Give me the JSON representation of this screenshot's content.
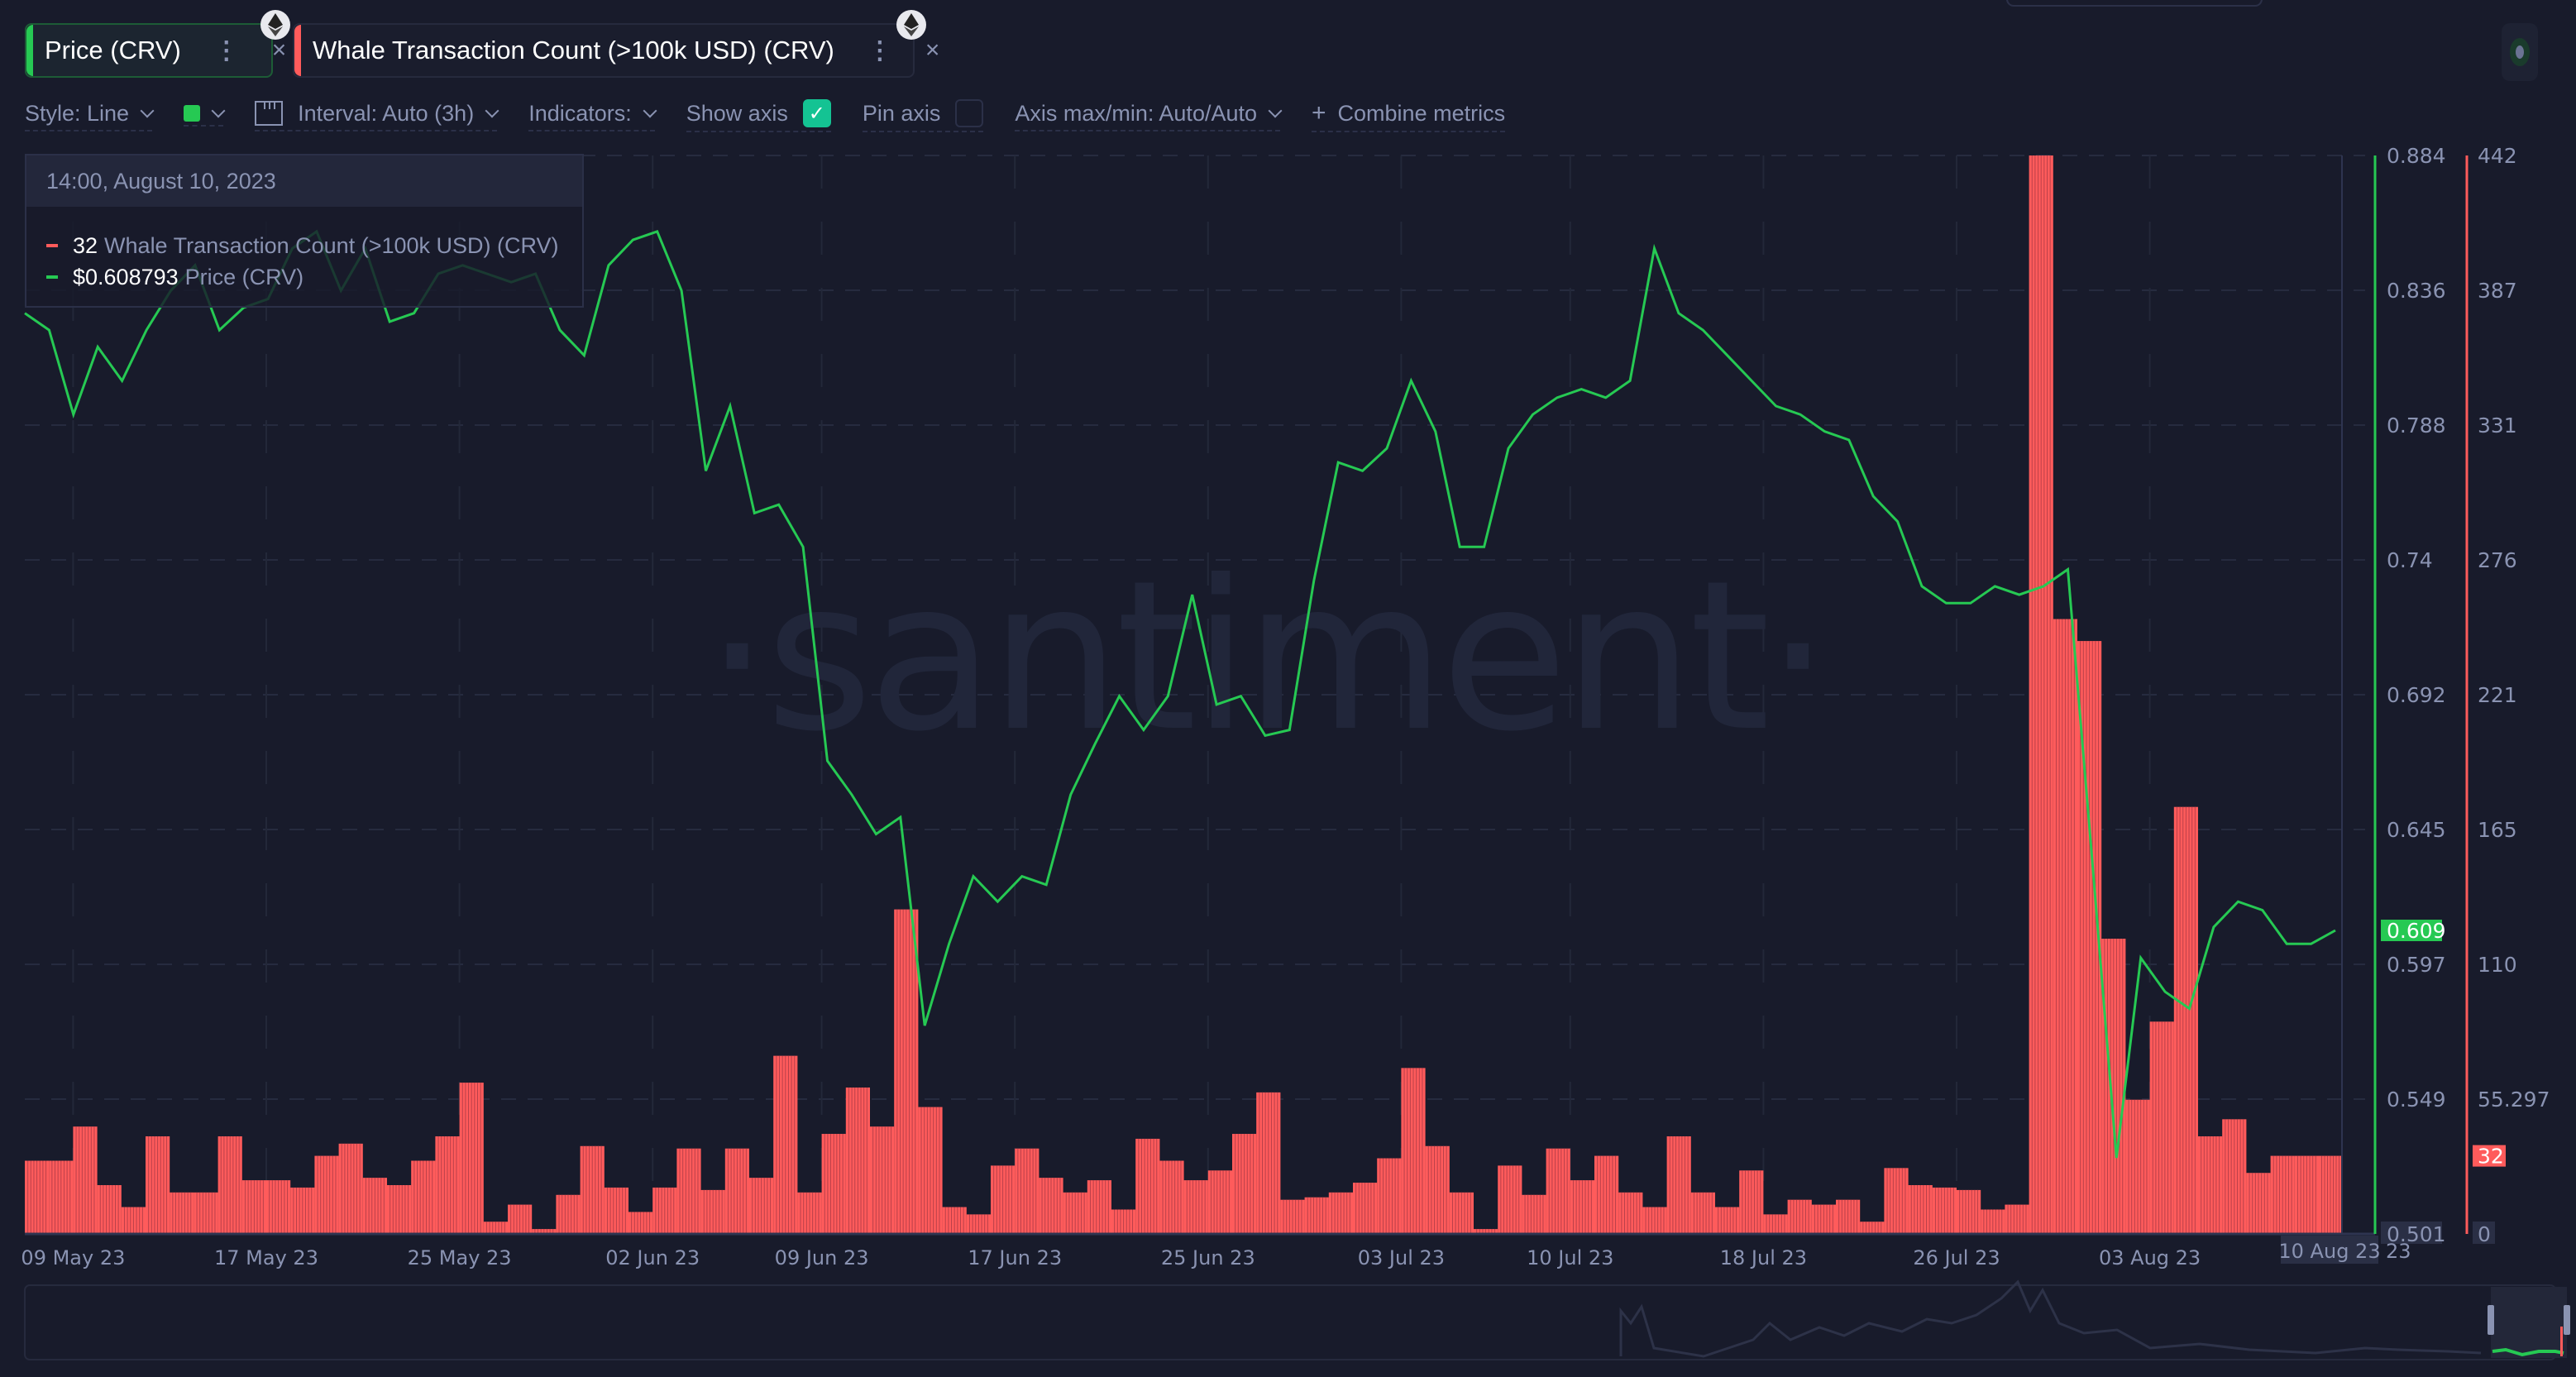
{
  "tabs": [
    {
      "label": "Price (CRV)",
      "color": "#26c953",
      "more_icon": "more-vertical-icon",
      "close_icon": "close-icon",
      "asset_icon": "ethereum-icon"
    },
    {
      "label": "Whale Transaction Count (>100k USD) (CRV)",
      "color": "#ff5b5b",
      "more_icon": "more-vertical-icon",
      "close_icon": "close-icon",
      "asset_icon": "ethereum-icon"
    }
  ],
  "toolbar": {
    "style_label": "Style: Line",
    "color_swatch": "#26c953",
    "interval_label": "Interval: Auto (3h)",
    "indicators_label": "Indicators:",
    "show_axis_label": "Show axis",
    "show_axis_checked": true,
    "pin_axis_label": "Pin axis",
    "pin_axis_checked": false,
    "axis_minmax_label": "Axis max/min: Auto/Auto",
    "combine_label": "Combine metrics",
    "combine_icon": "+"
  },
  "tooltip": {
    "datetime": "14:00, August 10, 2023",
    "rows": [
      {
        "value": "32",
        "name": "Whale Transaction Count (>100k USD) (CRV)",
        "color": "#ff5b5b"
      },
      {
        "value": "$0.608793",
        "name": "Price (CRV)",
        "color": "#26c953"
      }
    ]
  },
  "watermark": "·santiment·",
  "chart_data": {
    "type": "line+bar",
    "title": "",
    "x_start": "2023-05-07",
    "x_end": "2023-08-10 14:00",
    "x_ticks": [
      "09 May 23",
      "17 May 23",
      "25 May 23",
      "02 Jun 23",
      "09 Jun 23",
      "17 Jun 23",
      "25 Jun 23",
      "03 Jul 23",
      "10 Jul 23",
      "18 Jul 23",
      "26 Jul 23",
      "03 Aug 23"
    ],
    "x_tick_days": [
      2,
      10,
      18,
      26,
      33,
      41,
      49,
      57,
      64,
      72,
      80,
      88
    ],
    "x_cursor_label": "10 Aug 23",
    "x_cursor_trailing": "23",
    "grid": true,
    "series": [
      {
        "name": "Price (CRV)",
        "type": "line",
        "color": "#26c953",
        "axis": "left-inner",
        "ylim": [
          0.501,
          0.884
        ],
        "y_ticks": [
          "0.884",
          "0.836",
          "0.788",
          "0.74",
          "0.692",
          "0.645",
          "0.597",
          "0.549",
          "0.501"
        ],
        "last_value_label": "0.609",
        "interval": "1d (approx.)",
        "values": [
          0.828,
          0.822,
          0.792,
          0.816,
          0.804,
          0.822,
          0.836,
          0.845,
          0.822,
          0.83,
          0.833,
          0.851,
          0.857,
          0.836,
          0.851,
          0.825,
          0.828,
          0.842,
          0.845,
          0.842,
          0.839,
          0.842,
          0.822,
          0.813,
          0.845,
          0.854,
          0.857,
          0.836,
          0.772,
          0.795,
          0.757,
          0.76,
          0.745,
          0.669,
          0.657,
          0.643,
          0.649,
          0.575,
          0.604,
          0.628,
          0.619,
          0.628,
          0.625,
          0.657,
          0.675,
          0.692,
          0.68,
          0.692,
          0.728,
          0.689,
          0.692,
          0.678,
          0.68,
          0.733,
          0.775,
          0.772,
          0.78,
          0.804,
          0.786,
          0.745,
          0.745,
          0.78,
          0.792,
          0.798,
          0.801,
          0.798,
          0.804,
          0.851,
          0.828,
          0.822,
          0.813,
          0.804,
          0.795,
          0.792,
          0.786,
          0.783,
          0.763,
          0.754,
          0.731,
          0.725,
          0.725,
          0.731,
          0.728,
          0.731,
          0.737,
          0.634,
          0.528,
          0.599,
          0.587,
          0.581,
          0.61,
          0.619,
          0.616,
          0.604,
          0.604,
          0.608793
        ]
      },
      {
        "name": "Whale Transaction Count (>100k USD) (CRV)",
        "type": "bar",
        "color": "#ff5b5b",
        "axis": "right-outer",
        "ylim": [
          0,
          442
        ],
        "y_ticks": [
          "442",
          "387",
          "331",
          "276",
          "221",
          "165",
          "110",
          "55.297",
          "0"
        ],
        "last_value_label": "32",
        "interval": "1d",
        "values": [
          30,
          30,
          44,
          20,
          11,
          40,
          17,
          17,
          40,
          22,
          22,
          19,
          32,
          37,
          23,
          20,
          30,
          40,
          62,
          5,
          12,
          2,
          16,
          36,
          19,
          9,
          19,
          35,
          18,
          35,
          23,
          73,
          17,
          41,
          60,
          44,
          133,
          52,
          11,
          8,
          28,
          35,
          23,
          17,
          22,
          10,
          39,
          30,
          22,
          26,
          41,
          58,
          14,
          15,
          17,
          21,
          31,
          68,
          36,
          17,
          2,
          28,
          16,
          35,
          22,
          32,
          17,
          11,
          40,
          17,
          11,
          26,
          8,
          14,
          12,
          14,
          5,
          27,
          20,
          19,
          18,
          10,
          12,
          442,
          252,
          243,
          121,
          55,
          87,
          175,
          40,
          47,
          25,
          32,
          32,
          32
        ]
      }
    ]
  },
  "navigator": {
    "label": "range-navigator"
  }
}
